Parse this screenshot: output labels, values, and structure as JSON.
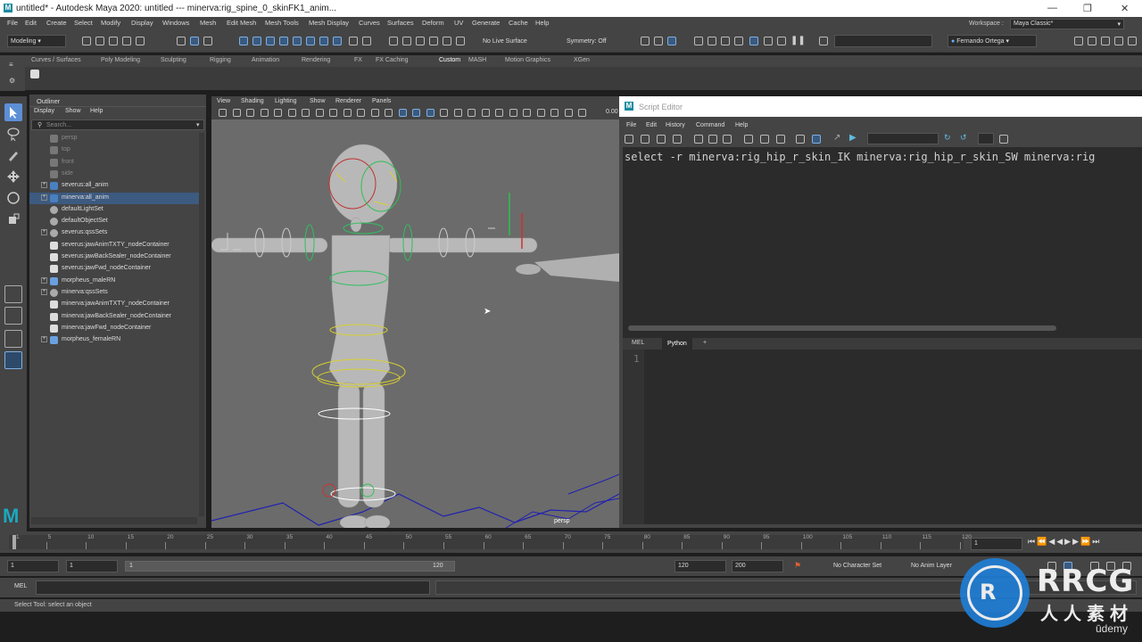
{
  "window": {
    "title": "untitled* - Autodesk Maya 2020: untitled   ---   minerva:rig_spine_0_skinFK1_anim...",
    "app_icon": "maya-icon"
  },
  "menus": [
    "File",
    "Edit",
    "Create",
    "Select",
    "Modify",
    "Display",
    "Windows",
    "Mesh",
    "Edit Mesh",
    "Mesh Tools",
    "Mesh Display",
    "Curves",
    "Surfaces",
    "Deform",
    "UV",
    "Generate",
    "Cache",
    "Help"
  ],
  "toolbar": {
    "mode": "Modeling",
    "live_surface": "No Live Surface",
    "symmetry": "Symmetry: Off",
    "user": "Fernando Ortega"
  },
  "workspace": {
    "label": "Workspace :",
    "value": "Maya Classic*"
  },
  "shelf_tabs": [
    {
      "label": "Curves / Surfaces"
    },
    {
      "label": "Poly Modeling"
    },
    {
      "label": "Sculpting"
    },
    {
      "label": "Rigging"
    },
    {
      "label": "Animation"
    },
    {
      "label": "Rendering"
    },
    {
      "label": "FX"
    },
    {
      "label": "FX Caching"
    },
    {
      "label": "Custom",
      "selected": true
    },
    {
      "label": "MASH"
    },
    {
      "label": "Motion Graphics"
    },
    {
      "label": "XGen"
    }
  ],
  "outliner": {
    "title": "Outliner",
    "menu": [
      "Display",
      "Show",
      "Help"
    ],
    "search_placeholder": "Search...",
    "items": [
      {
        "label": "persp",
        "dim": true,
        "icon": "camera-icon",
        "expand": ""
      },
      {
        "label": "top",
        "dim": true,
        "icon": "camera-icon",
        "expand": ""
      },
      {
        "label": "front",
        "dim": true,
        "icon": "camera-icon",
        "expand": ""
      },
      {
        "label": "side",
        "dim": true,
        "icon": "camera-icon",
        "expand": ""
      },
      {
        "label": "severus:all_anim",
        "icon": "transform-icon",
        "expand": "+"
      },
      {
        "label": "minerva:all_anim",
        "icon": "transform-icon",
        "expand": "+",
        "selected": true
      },
      {
        "label": "defaultLightSet",
        "icon": "set-icon",
        "expand": ""
      },
      {
        "label": "defaultObjectSet",
        "icon": "set-icon",
        "expand": ""
      },
      {
        "label": "severus:qssSets",
        "icon": "set-icon",
        "expand": "+"
      },
      {
        "label": "severus:jawAnimTXTY_nodeContainer",
        "icon": "container-icon",
        "expand": ""
      },
      {
        "label": "severus:jawBackSealer_nodeContainer",
        "icon": "container-icon",
        "expand": ""
      },
      {
        "label": "severus:jawFwd_nodeContainer",
        "icon": "container-icon",
        "expand": ""
      },
      {
        "label": "morpheus_maleRN",
        "icon": "reference-icon",
        "expand": "+"
      },
      {
        "label": "minerva:qssSets",
        "icon": "set-icon",
        "expand": "+"
      },
      {
        "label": "minerva:jawAnimTXTY_nodeContainer",
        "icon": "container-icon",
        "expand": ""
      },
      {
        "label": "minerva:jawBackSealer_nodeContainer",
        "icon": "container-icon",
        "expand": ""
      },
      {
        "label": "minerva:jawFwd_nodeContainer",
        "icon": "container-icon",
        "expand": ""
      },
      {
        "label": "morpheus_femaleRN",
        "icon": "reference-icon",
        "expand": "+"
      }
    ]
  },
  "viewport": {
    "menu": [
      "View",
      "Shading",
      "Lighting",
      "Show",
      "Renderer",
      "Panels"
    ],
    "camera_label": "persp",
    "value": "0.00"
  },
  "script_editor": {
    "title": "Script Editor",
    "menu": [
      "File",
      "Edit",
      "History",
      "Command",
      "Help"
    ],
    "history_line": "select -r minerva:rig_hip_r_skin_IK minerva:rig_hip_r_skin_SW minerva:rig",
    "tabs": [
      "MEL",
      "Python",
      "+"
    ],
    "line_number": "1"
  },
  "timeline": {
    "ticks": [
      "1",
      "5",
      "10",
      "15",
      "20",
      "25",
      "30",
      "35",
      "40",
      "45",
      "50",
      "55",
      "60",
      "65",
      "70",
      "75",
      "80",
      "85",
      "90",
      "95",
      "100",
      "105",
      "110",
      "115",
      "120"
    ],
    "current_frame": "1"
  },
  "range": {
    "start": "1",
    "start2": "1",
    "slider_start": "1",
    "slider_end": "120",
    "end": "120",
    "end2": "200",
    "character_set": "No Character Set",
    "anim_layer": "No Anim Layer"
  },
  "command_line": {
    "lang": "MEL"
  },
  "help_line": "Select Tool: select an object",
  "watermark": {
    "brand": "RRCG",
    "subtitle": "人人素材",
    "udemy": "ūdemy"
  }
}
